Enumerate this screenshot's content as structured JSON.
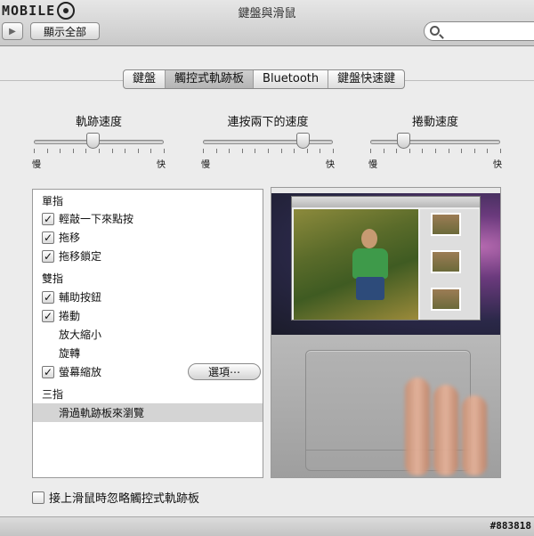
{
  "window": {
    "title": "鍵盤與滑鼠",
    "logo_text": "MOBILE",
    "watermark": "#883818"
  },
  "toolbar": {
    "back_glyph": "▶",
    "show_all_label": "顯示全部",
    "search_placeholder": ""
  },
  "tabs": [
    {
      "label": "鍵盤",
      "active": false
    },
    {
      "label": "觸控式軌跡板",
      "active": true
    },
    {
      "label": "Bluetooth",
      "active": false
    },
    {
      "label": "鍵盤快速鍵",
      "active": false
    }
  ],
  "sliders": [
    {
      "title": "軌跡速度",
      "min_label": "慢",
      "max_label": "快",
      "value": 0.45
    },
    {
      "title": "連按兩下的速度",
      "min_label": "慢",
      "max_label": "快",
      "value": 0.77
    },
    {
      "title": "捲動速度",
      "min_label": "慢",
      "max_label": "快",
      "value": 0.25
    }
  ],
  "gestures": {
    "one_finger": "單指",
    "tap_to_click": "輕敲一下來點按",
    "dragging": "拖移",
    "drag_lock": "拖移鎖定",
    "two_finger": "雙指",
    "secondary_click": "輔助按鈕",
    "scroll": "捲動",
    "zoom": "放大縮小",
    "rotate": "旋轉",
    "screen_zoom": "螢幕縮放",
    "three_finger": "三指",
    "swipe_navigate": "滑過軌跡板來瀏覽",
    "check_mark": "✓",
    "options_label": "選項⋯"
  },
  "footer": {
    "ignore_trackpad_label": "接上滑鼠時忽略觸控式軌跡板"
  }
}
